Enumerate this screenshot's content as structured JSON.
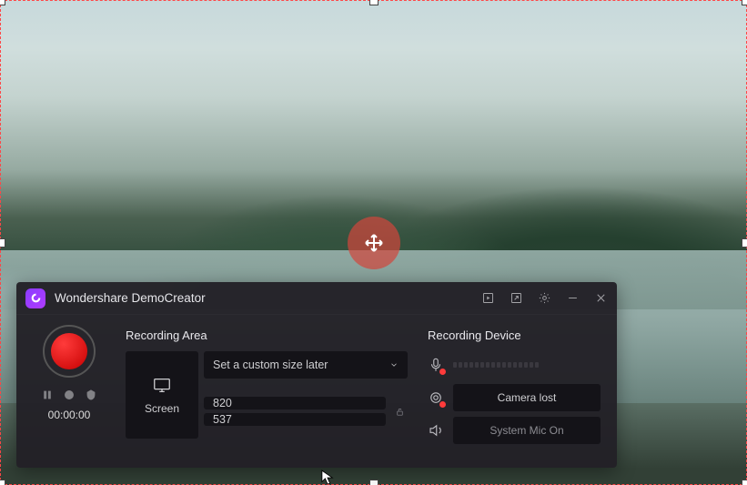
{
  "app": {
    "title": "Wondershare DemoCreator"
  },
  "record": {
    "timer": "00:00:00"
  },
  "area": {
    "title": "Recording Area",
    "screen_label": "Screen",
    "mode": "Set a custom size later",
    "width": "820",
    "height": "537"
  },
  "device": {
    "title": "Recording Device",
    "camera": "Camera lost",
    "mic": "System Mic On"
  }
}
